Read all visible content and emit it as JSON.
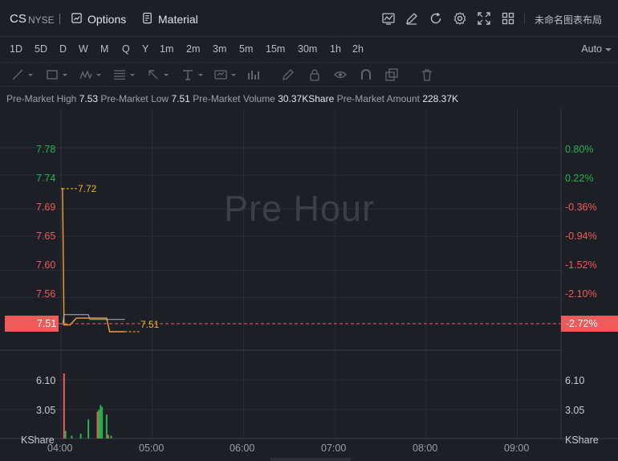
{
  "header": {
    "symbol": "CS",
    "exchange": "NYSE",
    "options_label": "Options",
    "material_label": "Material",
    "layout_name": "未命名图表布局",
    "tool_icons": [
      "indicator-icon",
      "draw-icon",
      "reset-icon",
      "settings-icon",
      "fullscreen-icon",
      "layout-icon"
    ]
  },
  "intervals": {
    "items": [
      "1D",
      "5D",
      "D",
      "W",
      "M",
      "Q",
      "Y",
      "1m",
      "2m",
      "3m",
      "5m",
      "15m",
      "30m",
      "1h",
      "2h"
    ],
    "active": "1D",
    "scale_mode": "Auto"
  },
  "drawing_tools": [
    "trend-line-icon",
    "rectangle-icon",
    "pattern-icon",
    "fib-icon",
    "arrow-icon",
    "text-icon",
    "measure-icon",
    "pen-icon",
    "lock-icon",
    "eye-icon",
    "magnet-icon",
    "clone-icon",
    "trash-icon"
  ],
  "stats": {
    "high_label": "Pre-Market High",
    "high_value": "7.53",
    "low_label": "Pre-Market Low",
    "low_value": "7.51",
    "volume_label": "Pre-Market Volume",
    "volume_value": "30.37KShare",
    "amount_label": "Pre-Market Amount",
    "amount_value": "228.37K"
  },
  "watermark": "Pre Hour",
  "price_axis": [
    "7.78",
    "7.74",
    "7.69",
    "7.65",
    "7.60",
    "7.56"
  ],
  "pct_axis": [
    "0.80%",
    "0.22%",
    "-0.36%",
    "-0.94%",
    "-1.52%",
    "-2.10%"
  ],
  "current_price": "7.51",
  "current_pct": "-2.72%",
  "high_marker": "7.72",
  "low_marker": "7.51",
  "volume_axis": {
    "left": [
      "6.10",
      "3.05"
    ],
    "right": [
      "6.10",
      "3.05"
    ],
    "unit": "KShare"
  },
  "time_axis": [
    "04:00",
    "05:00",
    "06:00",
    "07:00",
    "08:00",
    "09:00"
  ],
  "colors": {
    "up": "#26b34f",
    "down": "#f05a5a",
    "price_line": "#f0a030",
    "accent": "#f0b90b",
    "avg_line": "#b0b4bb"
  },
  "chart_data": {
    "type": "line",
    "x_label": "",
    "price": {
      "x": [
        "04:00",
        "04:01",
        "04:02",
        "04:06",
        "04:10",
        "04:20",
        "04:30",
        "04:32",
        "04:42"
      ],
      "values": [
        7.72,
        7.72,
        7.52,
        7.52,
        7.53,
        7.53,
        7.53,
        7.51,
        7.51
      ]
    },
    "volume": {
      "x_minutes": [
        2,
        3,
        7,
        13,
        18,
        24,
        25,
        26,
        27,
        30,
        31,
        33
      ],
      "values": [
        6.8,
        0.8,
        0.3,
        0.5,
        2.0,
        2.8,
        3.0,
        3.5,
        3.3,
        2.5,
        0.4,
        0.3
      ],
      "direction": [
        "down",
        "up",
        "up",
        "up",
        "up",
        "down",
        "up",
        "up",
        "up",
        "up",
        "down",
        "up"
      ]
    },
    "price_range": [
      7.49,
      7.82
    ],
    "volume_range": [
      0,
      9.15
    ]
  }
}
